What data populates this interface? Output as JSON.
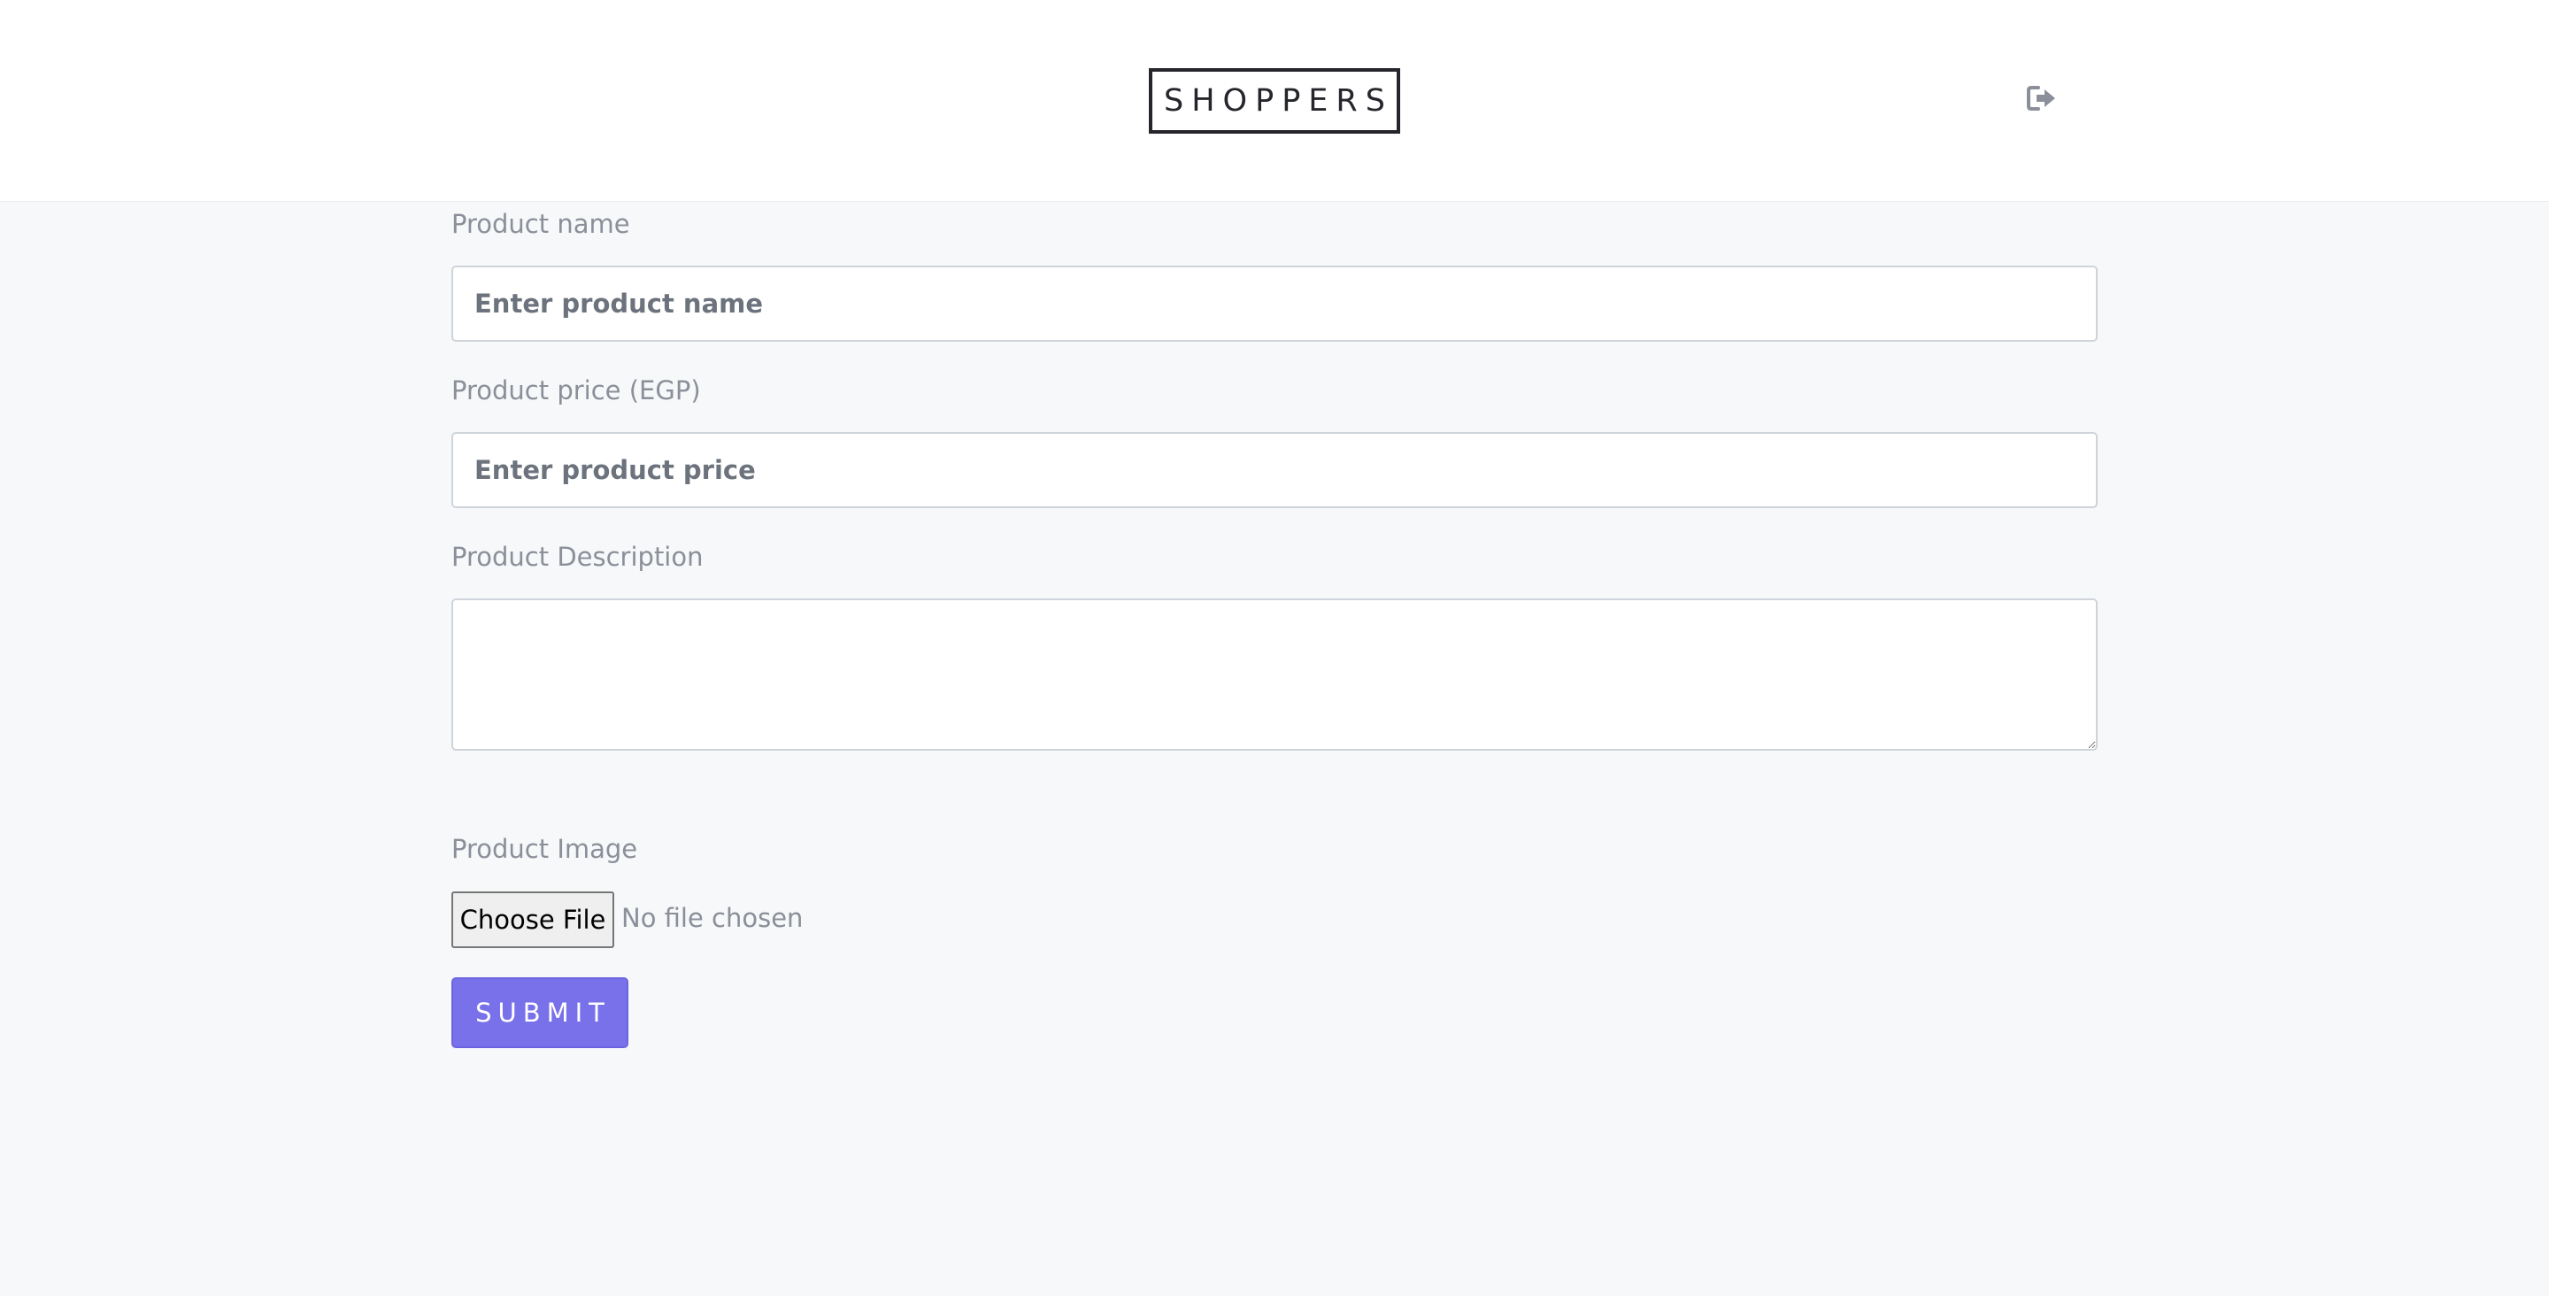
{
  "header": {
    "logo_text": "SHOPPERS",
    "logout_icon": "sign-out-icon"
  },
  "form": {
    "product_name": {
      "label": "Product name",
      "placeholder": "Enter product name",
      "value": ""
    },
    "product_price": {
      "label": "Product price (EGP)",
      "placeholder": "Enter product price",
      "value": ""
    },
    "product_description": {
      "label": "Product Description",
      "value": ""
    },
    "product_image": {
      "label": "Product Image",
      "button_label": "Choose File",
      "status": "No file chosen"
    },
    "submit_label": "SUBMIT"
  },
  "colors": {
    "accent": "#7971ea",
    "page_background": "#f7f8fa",
    "label": "#8b8f99",
    "logo": "#25262b"
  }
}
